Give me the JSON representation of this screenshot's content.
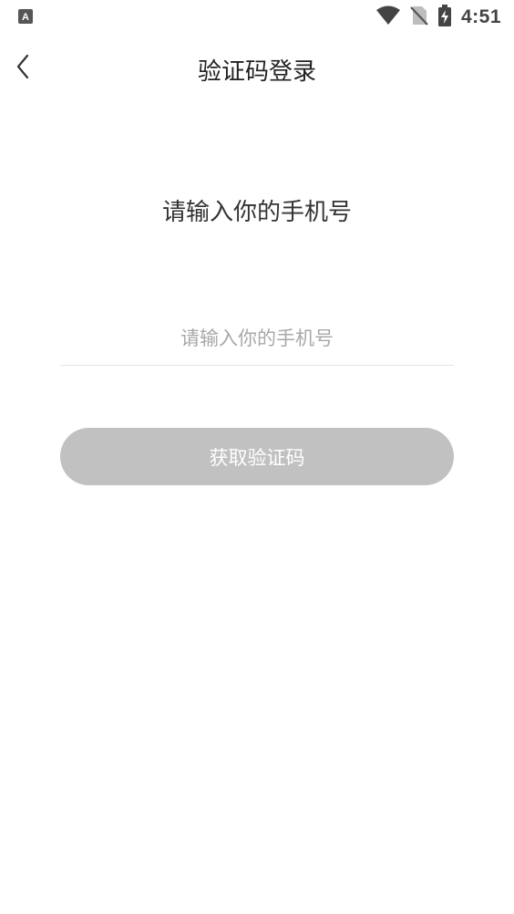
{
  "status_bar": {
    "time": "4:51",
    "left_icon": "keyboard-a-icon",
    "icons": [
      "wifi-icon",
      "no-sim-icon",
      "battery-charging-icon"
    ]
  },
  "app_bar": {
    "back_icon": "chevron-left-icon",
    "title": "验证码登录"
  },
  "login": {
    "prompt": "请输入你的手机号",
    "phone_placeholder": "请输入你的手机号",
    "phone_value": "",
    "get_code_label": "获取验证码"
  },
  "colors": {
    "button_disabled": "#c1c1c1",
    "title_text": "#222222",
    "placeholder_text": "#a8a8a8",
    "divider": "#e6e6e6"
  }
}
